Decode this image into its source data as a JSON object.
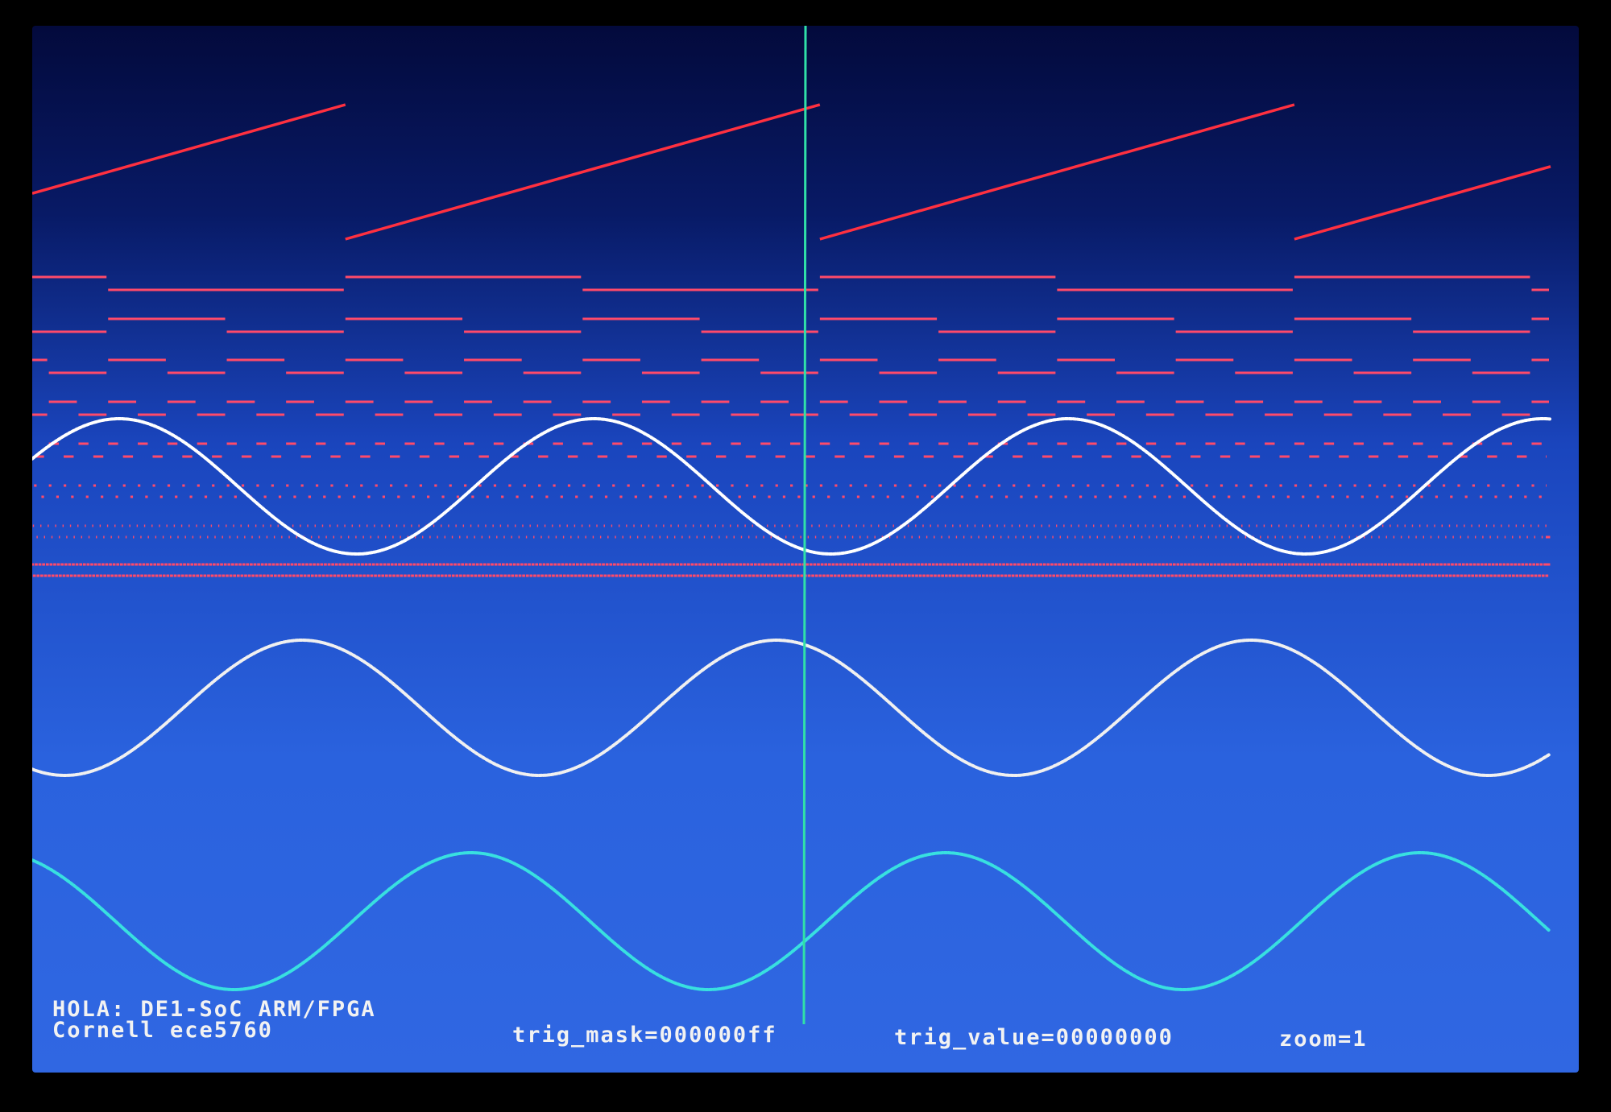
{
  "window": {
    "title": "HOLA: DE1-SoC ARM/FPGA",
    "subtitle": "Cornell ece5760"
  },
  "status": {
    "trig_mask": "trig_mask=000000ff",
    "trig_value": "trig_value=00000000",
    "zoom": "zoom=1"
  },
  "colors": {
    "background_top": "#030a3c",
    "background_bottom": "#3067e2",
    "sawtooth": "#ff3040",
    "digital_bits": "#ff4a6a",
    "sine_primary": "#ffffff",
    "sine_secondary": "#f0f0f0",
    "sine_tertiary": "#38e0e0",
    "trigger_cursor": "#30e0a8"
  },
  "chart_data": {
    "type": "line",
    "series": [
      {
        "kind": "sawtooth",
        "periods": 3.2,
        "phase": 0.66
      },
      {
        "kind": "digital",
        "bits": 8
      },
      {
        "kind": "sine",
        "periods": 3.2,
        "phase": 0.0
      },
      {
        "kind": "sine",
        "periods": 3.2,
        "phase": 0.25
      },
      {
        "kind": "sine",
        "periods": 3.2,
        "phase": 0.5
      }
    ],
    "trigger_position": 0.5
  }
}
